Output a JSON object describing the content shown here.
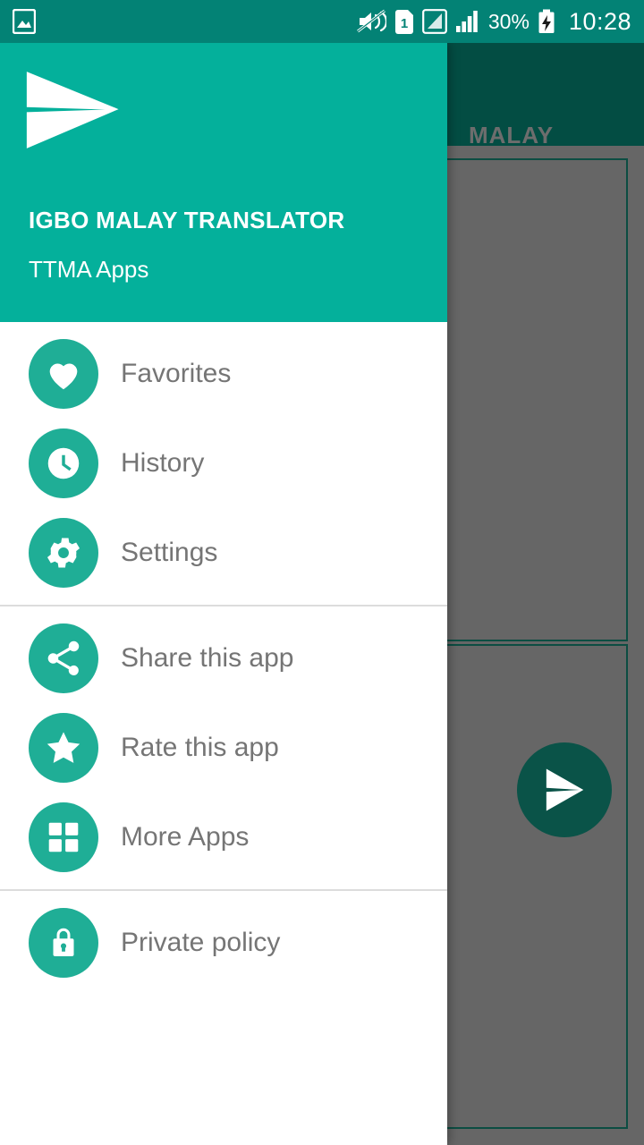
{
  "statusbar": {
    "left_icons": [
      {
        "name": "image-icon",
        "glyph": "picture"
      }
    ],
    "right_icons": [
      {
        "name": "mute-vibrate-off-icon"
      },
      {
        "name": "sim1-icon",
        "label": "1"
      },
      {
        "name": "signal-sim-icon"
      },
      {
        "name": "signal-bars-icon"
      }
    ],
    "battery_percent": "30%",
    "battery_state": "charging",
    "clock": "10:28"
  },
  "background_app": {
    "tab_label": "MALAY",
    "fab_icon": "send-icon"
  },
  "drawer": {
    "logo_icon": "paper-plane-logo",
    "title": "IGBO MALAY TRANSLATOR",
    "subtitle": "TTMA Apps",
    "groups": [
      {
        "items": [
          {
            "label": "Favorites",
            "icon": "heart-icon"
          },
          {
            "label": "History",
            "icon": "clock-icon"
          },
          {
            "label": "Settings",
            "icon": "gear-icon"
          }
        ]
      },
      {
        "items": [
          {
            "label": "Share this app",
            "icon": "share-icon"
          },
          {
            "label": "Rate this app",
            "icon": "star-icon"
          },
          {
            "label": "More Apps",
            "icon": "grid-apps-icon"
          }
        ]
      },
      {
        "items": [
          {
            "label": "Private policy",
            "icon": "lock-icon"
          }
        ]
      }
    ]
  },
  "colors": {
    "statusbar": "#038275",
    "drawer_header": "#04b09b",
    "icon_circle": "#1fae96",
    "appbar_dim": "#034d43",
    "scrim": "#666666",
    "menu_text": "#757575",
    "fab": "#0a5348"
  }
}
